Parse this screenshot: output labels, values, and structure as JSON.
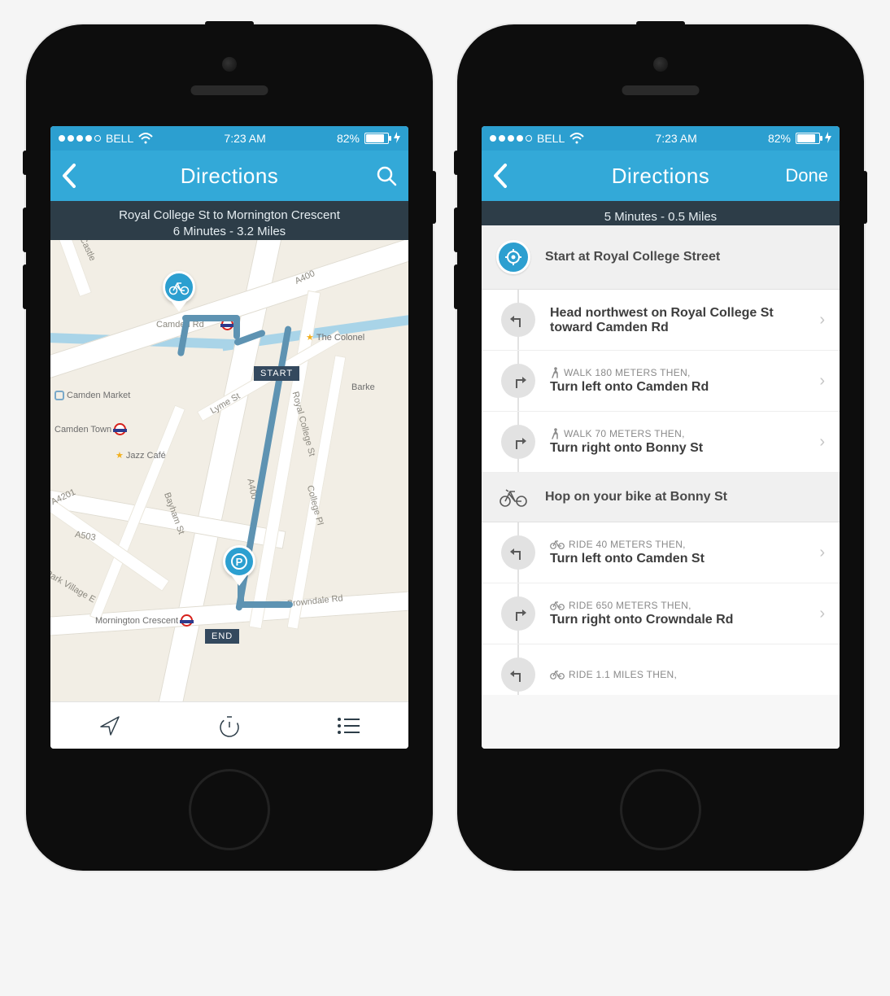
{
  "status": {
    "carrier": "BELL",
    "time": "7:23 AM",
    "battery": "82%"
  },
  "left": {
    "nav_title": "Directions",
    "route_line1": "Royal College St to Mornington Crescent",
    "route_line2": "6 Minutes - 3.2 Miles",
    "start_badge": "START",
    "end_badge": "END",
    "map": {
      "roads": {
        "camden_rd": "Camden Rd",
        "a400_1": "A400",
        "a400_2": "A400",
        "lyme_st": "Lyme St",
        "royal_college_st": "Royal College St",
        "college_pl": "College Pl",
        "bayham_st": "Bayham St",
        "crowndale_rd": "Crowndale Rd",
        "a503": "A503",
        "a4201": "A4201",
        "park_village_e": "Park Village E",
        "castle": "Castle"
      },
      "pois": {
        "camden_market": "Camden Market",
        "camden_town": "Camden Town",
        "jazz_cafe": "Jazz Café",
        "the_colonel": "The Colonel",
        "mornington_crescent": "Mornington Crescent",
        "barke": "Barke"
      }
    }
  },
  "right": {
    "nav_title": "Directions",
    "done_label": "Done",
    "summary": "5 Minutes - 0.5 Miles",
    "section_start": "Start at Royal College Street",
    "section_bike": "Hop on your bike at Bonny St",
    "steps": [
      {
        "meta": "",
        "main": "Head northwest on Royal College St toward Camden Rd",
        "icon": "turn-left",
        "mode": ""
      },
      {
        "meta": "WALK 180 METERS THEN,",
        "main": "Turn left onto Camden Rd",
        "icon": "turn-right",
        "mode": "walk"
      },
      {
        "meta": "WALK 70 METERS THEN,",
        "main": "Turn right onto Bonny St",
        "icon": "turn-right",
        "mode": "walk"
      },
      {
        "meta": "RIDE 40 METERS THEN,",
        "main": "Turn left onto Camden St",
        "icon": "turn-left",
        "mode": "ride"
      },
      {
        "meta": "RIDE 650 METERS THEN,",
        "main": "Turn right onto Crowndale Rd",
        "icon": "turn-right",
        "mode": "ride"
      },
      {
        "meta": "RIDE 1.1 MILES THEN,",
        "main": "",
        "icon": "turn-left",
        "mode": "ride"
      }
    ]
  }
}
